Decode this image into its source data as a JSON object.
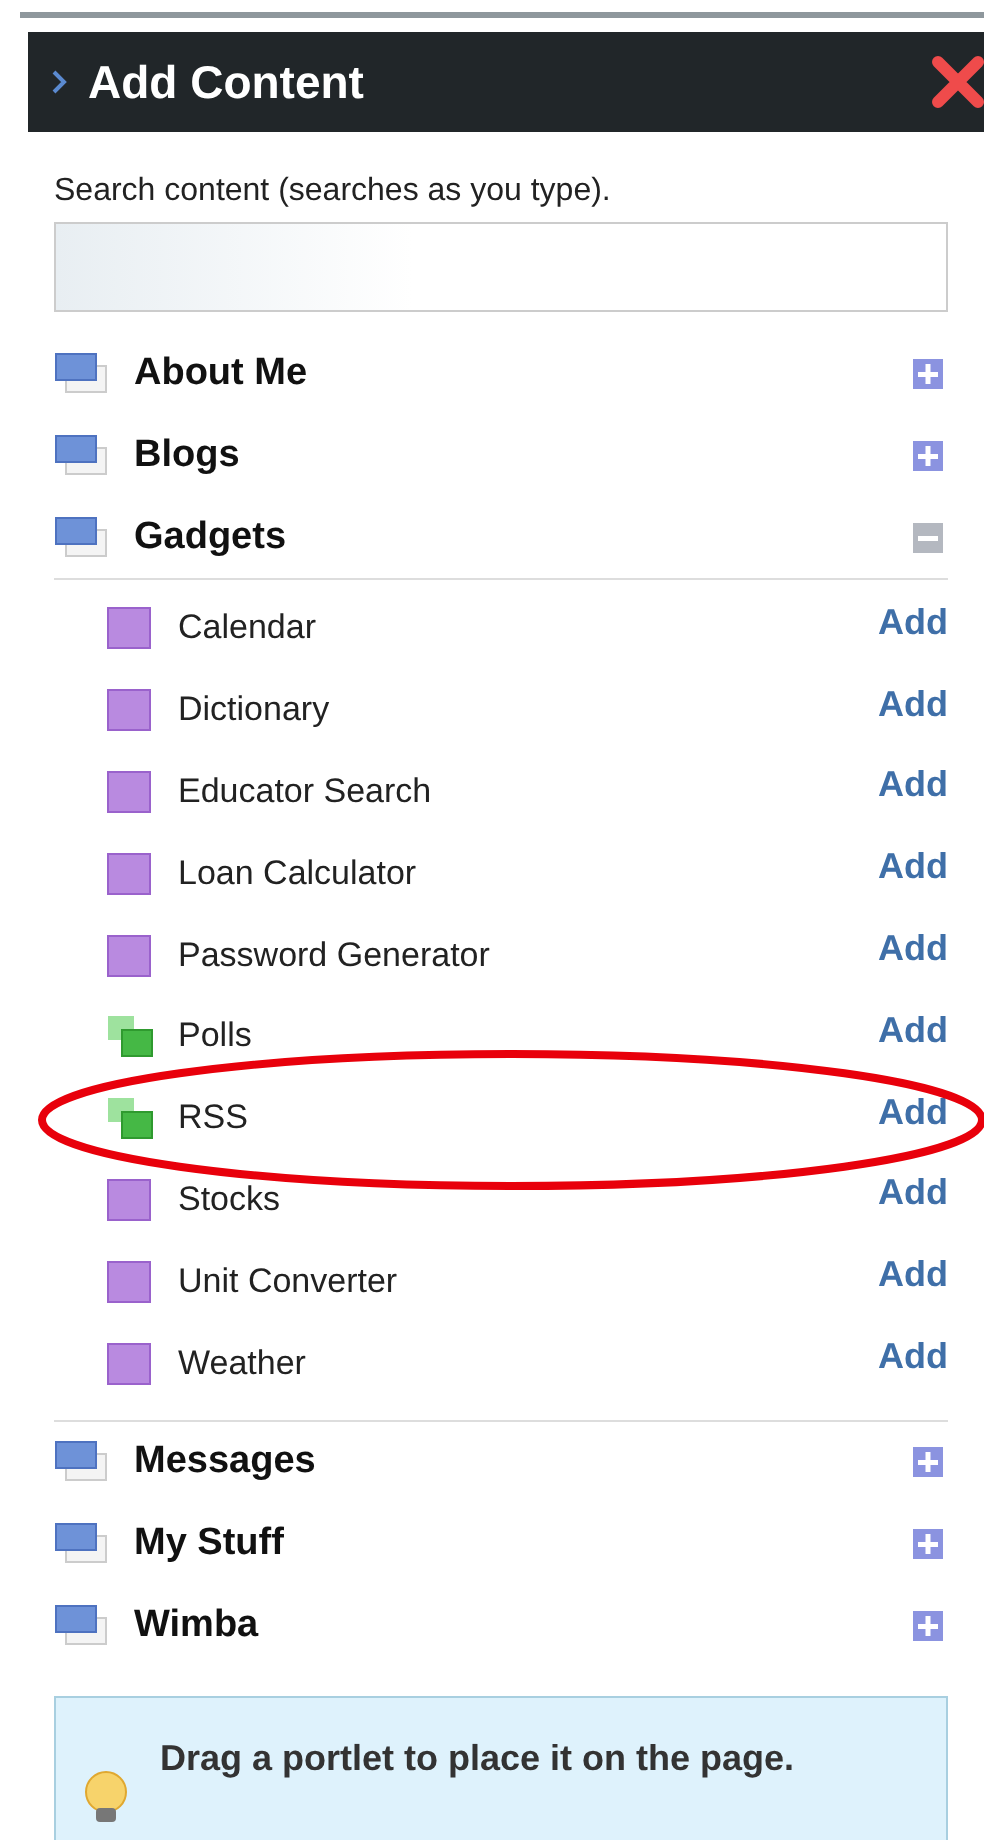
{
  "panel": {
    "title": "Add Content"
  },
  "search": {
    "label": "Search content (searches as you type)."
  },
  "categories": [
    {
      "name": "About Me",
      "expanded": false
    },
    {
      "name": "Blogs",
      "expanded": false
    },
    {
      "name": "Gadgets",
      "expanded": true,
      "items": [
        {
          "name": "Calendar",
          "kind": "single",
          "action": "Add"
        },
        {
          "name": "Dictionary",
          "kind": "single",
          "action": "Add"
        },
        {
          "name": "Educator Search",
          "kind": "single",
          "action": "Add"
        },
        {
          "name": "Loan Calculator",
          "kind": "single",
          "action": "Add"
        },
        {
          "name": "Password Generator",
          "kind": "single",
          "action": "Add"
        },
        {
          "name": "Polls",
          "kind": "multi",
          "action": "Add"
        },
        {
          "name": "RSS",
          "kind": "multi",
          "action": "Add",
          "highlighted": true
        },
        {
          "name": "Stocks",
          "kind": "single",
          "action": "Add"
        },
        {
          "name": "Unit Converter",
          "kind": "single",
          "action": "Add"
        },
        {
          "name": "Weather",
          "kind": "single",
          "action": "Add"
        }
      ]
    },
    {
      "name": "Messages",
      "expanded": false
    },
    {
      "name": "My Stuff",
      "expanded": false
    },
    {
      "name": "Wimba",
      "expanded": false
    }
  ],
  "hint": {
    "text": "Drag a portlet to place it on the page."
  }
}
